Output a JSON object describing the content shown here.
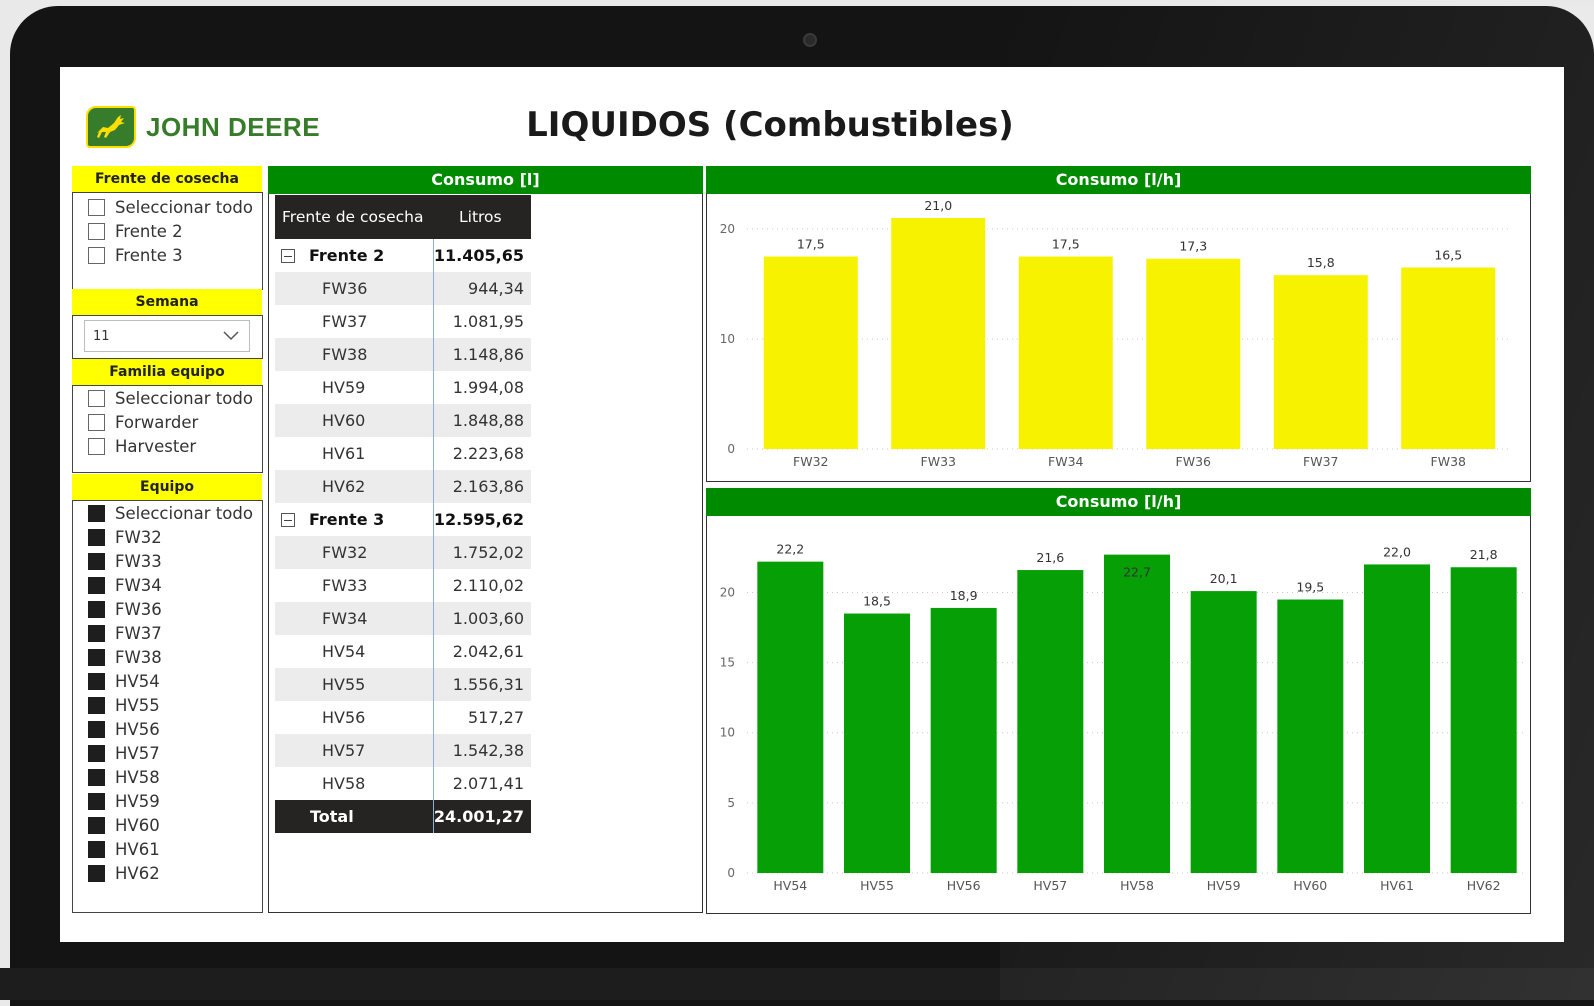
{
  "brand": {
    "name": "JOHN DEERE",
    "green": "#367c2b",
    "yellow": "#ffde00"
  },
  "page_title": "LIQUIDOS (Combustibles)",
  "slicers": {
    "frente": {
      "title": "Frente de cosecha",
      "options": [
        {
          "label": "Seleccionar todo",
          "checked": false
        },
        {
          "label": "Frente 2",
          "checked": false
        },
        {
          "label": "Frente 3",
          "checked": false
        }
      ]
    },
    "semana": {
      "title": "Semana",
      "value": "11"
    },
    "familia": {
      "title": "Familia equipo",
      "options": [
        {
          "label": "Seleccionar todo",
          "checked": false
        },
        {
          "label": "Forwarder",
          "checked": false
        },
        {
          "label": "Harvester",
          "checked": false
        }
      ]
    },
    "equipo": {
      "title": "Equipo",
      "options": [
        {
          "label": "Seleccionar todo",
          "checked": true
        },
        {
          "label": "FW32",
          "checked": true
        },
        {
          "label": "FW33",
          "checked": true
        },
        {
          "label": "FW34",
          "checked": true
        },
        {
          "label": "FW36",
          "checked": true
        },
        {
          "label": "FW37",
          "checked": true
        },
        {
          "label": "FW38",
          "checked": true
        },
        {
          "label": "HV54",
          "checked": true
        },
        {
          "label": "HV55",
          "checked": true
        },
        {
          "label": "HV56",
          "checked": true
        },
        {
          "label": "HV57",
          "checked": true
        },
        {
          "label": "HV58",
          "checked": true
        },
        {
          "label": "HV59",
          "checked": true
        },
        {
          "label": "HV60",
          "checked": true
        },
        {
          "label": "HV61",
          "checked": true
        },
        {
          "label": "HV62",
          "checked": true
        }
      ]
    }
  },
  "table": {
    "title": "Consumo [l]",
    "headers": [
      "Frente de cosecha",
      "Litros"
    ],
    "groups": [
      {
        "name": "Frente 2",
        "total": "11.405,65",
        "rows": [
          {
            "name": "FW36",
            "value": "944,34"
          },
          {
            "name": "FW37",
            "value": "1.081,95"
          },
          {
            "name": "FW38",
            "value": "1.148,86"
          },
          {
            "name": "HV59",
            "value": "1.994,08"
          },
          {
            "name": "HV60",
            "value": "1.848,88"
          },
          {
            "name": "HV61",
            "value": "2.223,68"
          },
          {
            "name": "HV62",
            "value": "2.163,86"
          }
        ]
      },
      {
        "name": "Frente 3",
        "total": "12.595,62",
        "rows": [
          {
            "name": "FW32",
            "value": "1.752,02"
          },
          {
            "name": "FW33",
            "value": "2.110,02"
          },
          {
            "name": "FW34",
            "value": "1.003,60"
          },
          {
            "name": "HV54",
            "value": "2.042,61"
          },
          {
            "name": "HV55",
            "value": "1.556,31"
          },
          {
            "name": "HV56",
            "value": "517,27"
          },
          {
            "name": "HV57",
            "value": "1.542,38"
          },
          {
            "name": "HV58",
            "value": "2.071,41"
          }
        ]
      }
    ],
    "total_label": "Total",
    "total_value": "24.001,27"
  },
  "chart_data": [
    {
      "type": "bar",
      "title": "Consumo [l/h]",
      "categories": [
        "FW32",
        "FW33",
        "FW34",
        "FW36",
        "FW37",
        "FW38"
      ],
      "values": [
        17.5,
        21.0,
        17.5,
        17.3,
        15.8,
        16.5
      ],
      "labels": [
        "17,5",
        "21,0",
        "17,5",
        "17,3",
        "15,8",
        "16,5"
      ],
      "ylim": [
        0,
        22
      ],
      "yticks": [
        0,
        10,
        20
      ],
      "color": "#f7f300",
      "grid": true,
      "legend": "none"
    },
    {
      "type": "bar",
      "title": "Consumo [l/h]",
      "categories": [
        "HV54",
        "HV55",
        "HV56",
        "HV57",
        "HV58",
        "HV59",
        "HV60",
        "HV61",
        "HV62"
      ],
      "values": [
        22.2,
        18.5,
        18.9,
        21.6,
        22.7,
        20.1,
        19.5,
        22.0,
        21.8
      ],
      "labels": [
        "22,2",
        "18,5",
        "18,9",
        "21,6",
        "22,7",
        "20,1",
        "19,5",
        "22,0",
        "21,8"
      ],
      "ylim": [
        0,
        23.6
      ],
      "yticks": [
        0,
        5,
        10,
        15,
        20
      ],
      "color": "#06a006",
      "grid": true,
      "legend": "none"
    }
  ]
}
